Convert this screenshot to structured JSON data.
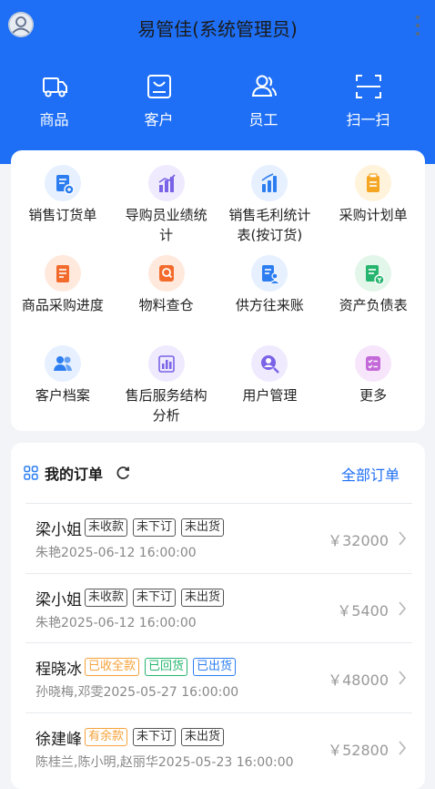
{
  "header": {
    "title": "易管佳(系统管理员)",
    "nav": [
      {
        "label": "商品",
        "icon": "truck-icon"
      },
      {
        "label": "客户",
        "icon": "customer-bag-icon"
      },
      {
        "label": "员工",
        "icon": "staff-icon"
      },
      {
        "label": "扫一扫",
        "icon": "scan-icon"
      }
    ]
  },
  "functions": [
    {
      "label": "销售订货单",
      "icon": "sales-order-icon",
      "color": "#2c7ef0",
      "bg": "#e6f0ff"
    },
    {
      "label": "导购员业绩统计",
      "icon": "bar-chart-icon",
      "color": "#7a63e6",
      "bg": "#efeafe"
    },
    {
      "label": "销售毛利统计表(按订货)",
      "icon": "column-chart-icon",
      "color": "#2c7ef0",
      "bg": "#e6f0ff"
    },
    {
      "label": "采购计划单",
      "icon": "clipboard-icon",
      "color": "#f5a623",
      "bg": "#fff3dc"
    },
    {
      "label": "商品采购进度",
      "icon": "document-list-icon",
      "color": "#f36b2c",
      "bg": "#ffe9dd"
    },
    {
      "label": "物料查仓",
      "icon": "search-doc-icon",
      "color": "#f36b2c",
      "bg": "#ffe9dd"
    },
    {
      "label": "供方往来账",
      "icon": "supplier-account-icon",
      "color": "#2c7ef0",
      "bg": "#e6f0ff"
    },
    {
      "label": "资产负债表",
      "icon": "balance-sheet-icon",
      "color": "#26b56e",
      "bg": "#e2f6ea"
    },
    {
      "label": "客户档案",
      "icon": "customer-profile-icon",
      "color": "#2c7ef0",
      "bg": "#e6f0ff"
    },
    {
      "label": "售后服务结构分析",
      "icon": "analysis-chart-icon",
      "color": "#7a63e6",
      "bg": "#efeafe"
    },
    {
      "label": "用户管理",
      "icon": "user-manage-icon",
      "color": "#7a63e6",
      "bg": "#efeafe"
    },
    {
      "label": "更多",
      "icon": "more-grid-icon",
      "color": "#c36ad8",
      "bg": "#f7e6fb"
    }
  ],
  "orders_section": {
    "title": "我的订单",
    "all_label": "全部订单",
    "orders": [
      {
        "name": "梁小姐",
        "tags": [
          {
            "text": "未收款",
            "style": "gray"
          },
          {
            "text": "未下订",
            "style": "gray"
          },
          {
            "text": "未出货",
            "style": "gray"
          }
        ],
        "sub": "朱艳2025-06-12 16:00:00",
        "amount": "￥32000"
      },
      {
        "name": "梁小姐",
        "tags": [
          {
            "text": "未收款",
            "style": "gray"
          },
          {
            "text": "未下订",
            "style": "gray"
          },
          {
            "text": "未出货",
            "style": "gray"
          }
        ],
        "sub": "朱艳2025-06-12 16:00:00",
        "amount": "￥5400"
      },
      {
        "name": "程晓冰",
        "tags": [
          {
            "text": "已收全款",
            "style": "orange"
          },
          {
            "text": "已回货",
            "style": "green"
          },
          {
            "text": "已出货",
            "style": "blue"
          }
        ],
        "sub": "孙晓梅,邓雯2025-05-27 16:00:00",
        "amount": "￥48000"
      },
      {
        "name": "徐建峰",
        "tags": [
          {
            "text": "有余款",
            "style": "orange"
          },
          {
            "text": "未下订",
            "style": "gray"
          },
          {
            "text": "未出货",
            "style": "gray"
          }
        ],
        "sub": "陈桂兰,陈小明,赵丽华2025-05-23 16:00:00",
        "amount": "￥52800"
      }
    ]
  },
  "colors": {
    "primary": "#1e6ff5",
    "background": "#f2f4f7"
  }
}
